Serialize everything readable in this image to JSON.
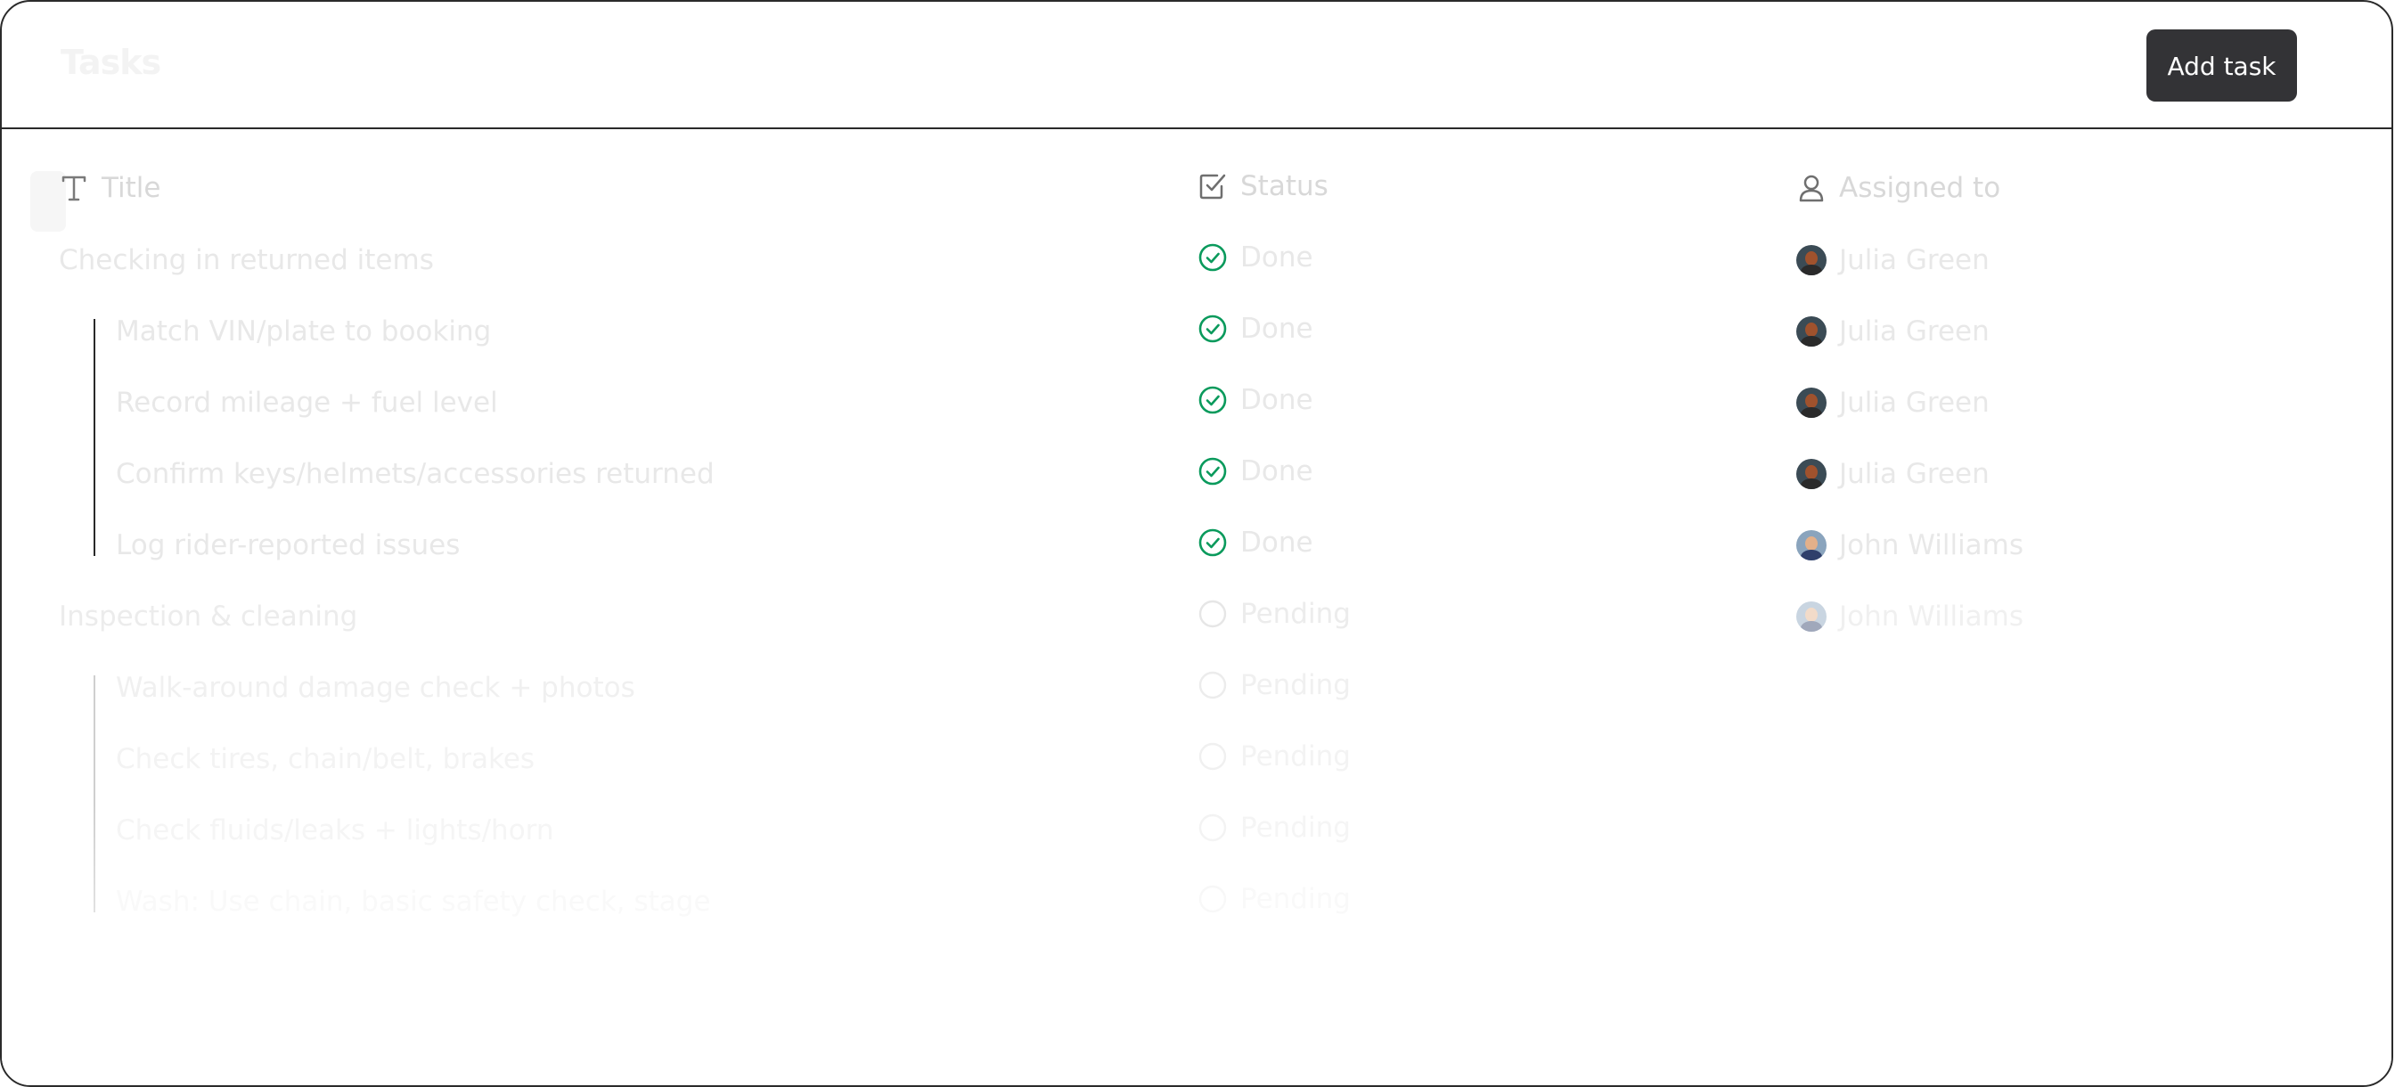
{
  "header": {
    "title": "Tasks",
    "add_button_label": "Add task"
  },
  "columns": {
    "title": "Title",
    "status": "Status",
    "assigned": "Assigned to"
  },
  "colors": {
    "done_green": "#0a9a5c",
    "button_bg": "#333336",
    "faint_text": "#e0e0e0"
  },
  "rows": [
    {
      "title": "Checking in returned items",
      "status": "Done",
      "assignee": "Julia Green"
    },
    {
      "title": "Match VIN/plate to booking",
      "status": "Done",
      "assignee": "Julia Green"
    },
    {
      "title": "Record mileage + fuel level",
      "status": "Done",
      "assignee": "Julia Green"
    },
    {
      "title": "Confirm keys/helmets/accessories returned",
      "status": "Done",
      "assignee": "Julia Green"
    },
    {
      "title": "Log rider-reported issues",
      "status": "Done",
      "assignee": "John Williams"
    },
    {
      "title": "Inspection & cleaning",
      "status": "Pending",
      "assignee": "John Williams"
    },
    {
      "title": "Walk-around damage check + photos",
      "status": "Pending",
      "assignee": ""
    },
    {
      "title": "Check tires, chain/belt, brakes",
      "status": "Pending",
      "assignee": ""
    },
    {
      "title": "Check fluids/leaks + lights/horn",
      "status": "Pending",
      "assignee": ""
    },
    {
      "title": "Wash: Use chain, basic safety check, stage",
      "status": "Pending",
      "assignee": ""
    }
  ]
}
